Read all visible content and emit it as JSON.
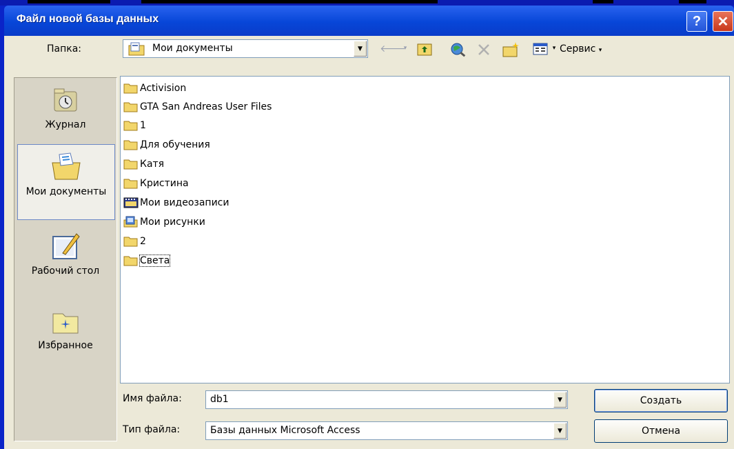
{
  "dialog": {
    "title": "Файл новой базы данных",
    "help_label": "?",
    "close_label": "✕"
  },
  "toolbar": {
    "folder_label": "Папка:",
    "folder_value": "Мои документы",
    "tools_label": "Сервис"
  },
  "places": [
    {
      "label": "Журнал",
      "icon": "history-icon"
    },
    {
      "label": "Мои документы",
      "icon": "my-documents-icon",
      "selected": true
    },
    {
      "label": "Рабочий стол",
      "icon": "desktop-icon"
    },
    {
      "label": "Избранное",
      "icon": "favorites-icon"
    }
  ],
  "files": [
    {
      "name": "Activision",
      "icon": "folder-icon"
    },
    {
      "name": "GTA San Andreas User Files",
      "icon": "folder-icon"
    },
    {
      "name": "1",
      "icon": "folder-icon"
    },
    {
      "name": "Для обучения",
      "icon": "folder-icon"
    },
    {
      "name": "Катя",
      "icon": "folder-icon"
    },
    {
      "name": "Кристина",
      "icon": "folder-icon"
    },
    {
      "name": "Мои видеозаписи",
      "icon": "video-folder-icon"
    },
    {
      "name": "Мои рисунки",
      "icon": "pictures-folder-icon"
    },
    {
      "name": "2",
      "icon": "folder-icon"
    },
    {
      "name": "Света",
      "icon": "folder-icon",
      "focused": true
    }
  ],
  "form": {
    "filename_label": "Имя файла:",
    "filename_value": "db1",
    "filetype_label": "Тип файла:",
    "filetype_value": "Базы данных Microsoft Access",
    "create_label": "Создать",
    "cancel_label": "Отмена"
  },
  "colors": {
    "titlebar": "#0a3cc9",
    "dialog_face": "#ece9d8",
    "slide_background": "#0a24c8",
    "folder_yellow": "#f2d66b"
  }
}
